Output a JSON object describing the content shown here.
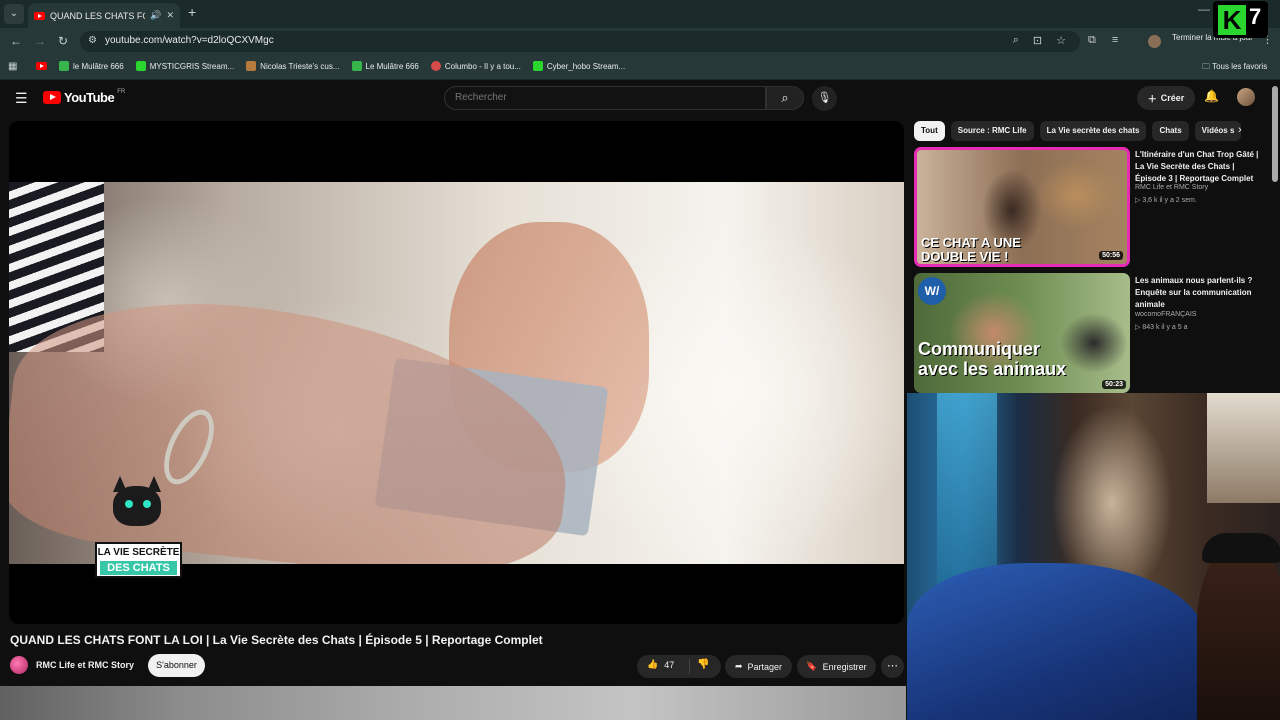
{
  "browser": {
    "tab_title": "QUAND LES CHATS FONT LA LOI",
    "new_tab": "+",
    "url": "youtube.com/watch?v=d2loQCXVMgc",
    "update_label": "Terminer la mise à jour",
    "bookmarks": [
      {
        "label": "le Mulâtre 666",
        "color": "#35b54a"
      },
      {
        "label": "MYSTICGRIS Stream...",
        "color": "#29d52e"
      },
      {
        "label": "Nicolas Trieste's cus...",
        "color": "#b57a3c"
      },
      {
        "label": "Le Mulâtre 666",
        "color": "#35b54a"
      },
      {
        "label": "Columbo - Il y a tou...",
        "color": "#d74a4a"
      },
      {
        "label": "Cyber_hobo Stream...",
        "color": "#29d52e"
      }
    ],
    "all_bookmarks": "Tous les favoris"
  },
  "overlay_logo": {
    "letter": "K",
    "number": "7"
  },
  "youtube": {
    "logo_text": "YouTube",
    "logo_region": "FR",
    "search_placeholder": "Rechercher",
    "create_label": "Créer"
  },
  "video": {
    "overlay_line1": "LA VIE SECRÈTE",
    "overlay_line2": "DES CHATS",
    "title": "QUAND LES CHATS FONT LA LOI | La Vie Secrète des Chats | Épisode 5 | Reportage Complet",
    "channel": "RMC Life et RMC Story",
    "subscribe_label": "S'abonner",
    "likes": "47",
    "share_label": "Partager",
    "save_label": "Enregistrer"
  },
  "chips": [
    "Tout",
    "Source : RMC Life",
    "La Vie secrète des chats",
    "Chats",
    "Vidéos s"
  ],
  "recommendations": [
    {
      "title": "L'Itinéraire d'un Chat Trop Gâté | La Vie Secrète des Chats | Épisode 3 | Reportage Complet",
      "channel": "RMC Life et RMC Story",
      "meta": "▷ 3,6 k   il y a 2 sem.",
      "duration": "50:56",
      "thumb_text_1": "CE CHAT A UNE",
      "thumb_text_2": "DOUBLE VIE !"
    },
    {
      "title": "Les animaux nous parlent-ils ? Enquête sur la communication animale",
      "channel": "wocomoFRANÇAIS",
      "meta": "▷ 843 k   il y a 5 a",
      "duration": "50:23",
      "thumb_logo": "W/",
      "thumb_text_1": "Communiquer",
      "thumb_text_2": "avec les animaux"
    }
  ]
}
